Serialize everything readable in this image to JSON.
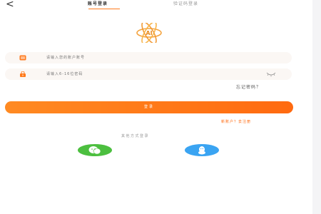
{
  "header": {
    "back_icon": "chevron-left-icon",
    "tabs": [
      {
        "label": "账号登录",
        "active": true
      },
      {
        "label": "验证码登录",
        "active": false
      }
    ]
  },
  "logo": {
    "text": "AI"
  },
  "form": {
    "phone": {
      "placeholder": "请输入您的账户账号",
      "icon": "user-icon"
    },
    "password": {
      "placeholder": "请输入6-16位密码",
      "icon": "lock-icon",
      "toggle_icon": "eye-closed-icon"
    },
    "forgot_label": "忘记密码？",
    "login_label": "登录",
    "register_label": "新账户？去注册"
  },
  "social": {
    "label": "其他方式登录",
    "options": [
      {
        "name": "wechat",
        "icon": "wechat-icon",
        "color": "#4cbf3f"
      },
      {
        "name": "qq",
        "icon": "qq-icon",
        "color": "#3aa4f2"
      }
    ]
  },
  "colors": {
    "accent": "#ff7a1c",
    "input_bg": "#fbf7f4"
  }
}
